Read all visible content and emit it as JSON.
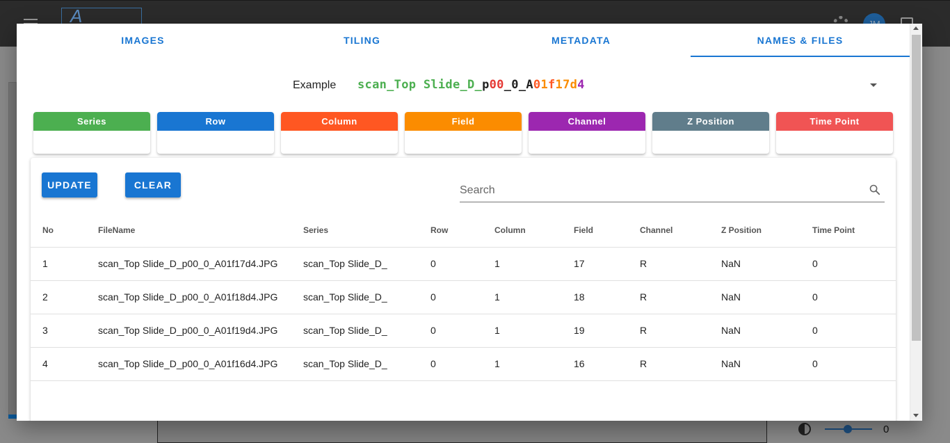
{
  "app": {
    "avatar_initials": "JM",
    "slider_value": "0"
  },
  "tabs": [
    {
      "label": "IMAGES",
      "active": false
    },
    {
      "label": "TILING",
      "active": false
    },
    {
      "label": "METADATA",
      "active": false
    },
    {
      "label": "NAMES & FILES",
      "active": true
    }
  ],
  "example": {
    "label": "Example",
    "segments": {
      "series": "scan_Top Slide_D_",
      "p": "p",
      "row": "00",
      "u1": "_",
      "col": "0",
      "u2": "_",
      "a": "A",
      "z": "0",
      "field1": "1",
      "f": "f",
      "field2": "17",
      "d": "d",
      "channel": "4"
    }
  },
  "chips": [
    {
      "label": "Series",
      "color": "#4caf50"
    },
    {
      "label": "Row",
      "color": "#1976d2"
    },
    {
      "label": "Column",
      "color": "#ff5722"
    },
    {
      "label": "Field",
      "color": "#fb8c00"
    },
    {
      "label": "Channel",
      "color": "#9c27b0"
    },
    {
      "label": "Z Position",
      "color": "#607d8b"
    },
    {
      "label": "Time Point",
      "color": "#f05454"
    }
  ],
  "actions": {
    "update_label": "UPDATE",
    "clear_label": "CLEAR"
  },
  "search": {
    "placeholder": "Search",
    "icon": "search-icon"
  },
  "table": {
    "columns": [
      "No",
      "FileName",
      "Series",
      "Row",
      "Column",
      "Field",
      "Channel",
      "Z Position",
      "Time Point"
    ],
    "rows": [
      [
        "1",
        "scan_Top Slide_D_p00_0_A01f17d4.JPG",
        "scan_Top Slide_D_",
        "0",
        "1",
        "17",
        "R",
        "NaN",
        "0"
      ],
      [
        "2",
        "scan_Top Slide_D_p00_0_A01f18d4.JPG",
        "scan_Top Slide_D_",
        "0",
        "1",
        "18",
        "R",
        "NaN",
        "0"
      ],
      [
        "3",
        "scan_Top Slide_D_p00_0_A01f19d4.JPG",
        "scan_Top Slide_D_",
        "0",
        "1",
        "19",
        "R",
        "NaN",
        "0"
      ],
      [
        "4",
        "scan_Top Slide_D_p00_0_A01f16d4.JPG",
        "scan_Top Slide_D_",
        "0",
        "1",
        "16",
        "R",
        "NaN",
        "0"
      ]
    ]
  }
}
